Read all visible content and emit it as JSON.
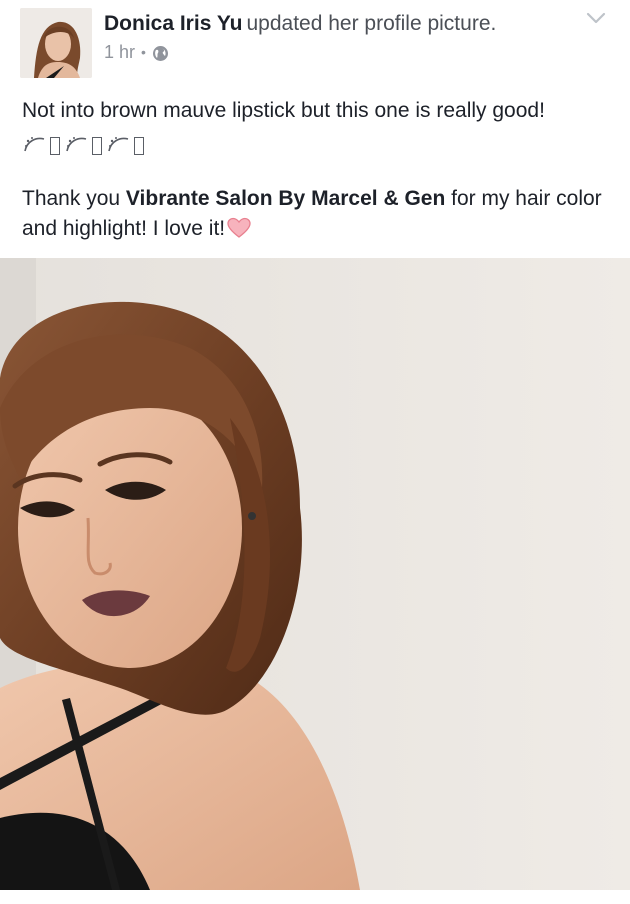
{
  "post": {
    "author_name": "Donica Iris Yu",
    "action": "updated her profile picture.",
    "timestamp": "1 hr",
    "separator": "•",
    "privacy_icon": "globe-icon",
    "menu_icon": "chevron-down-icon",
    "text_line_1": "Not into brown mauve lipstick but this one is really good!",
    "emoji_icon": "sparkles-emoji",
    "emoji_count": 3,
    "text_2_prefix": "Thank you ",
    "tagged_page": "Vibrante Salon By Marcel & Gen",
    "text_2_suffix": " for my hair color and highlight! I love it!",
    "heart_icon": "heart-icon",
    "photo": "profile-photo",
    "colors": {
      "name": "#1d2129",
      "meta": "#90949c",
      "heart": "#f7a8b3",
      "photo_background": "#ece8e3"
    }
  }
}
